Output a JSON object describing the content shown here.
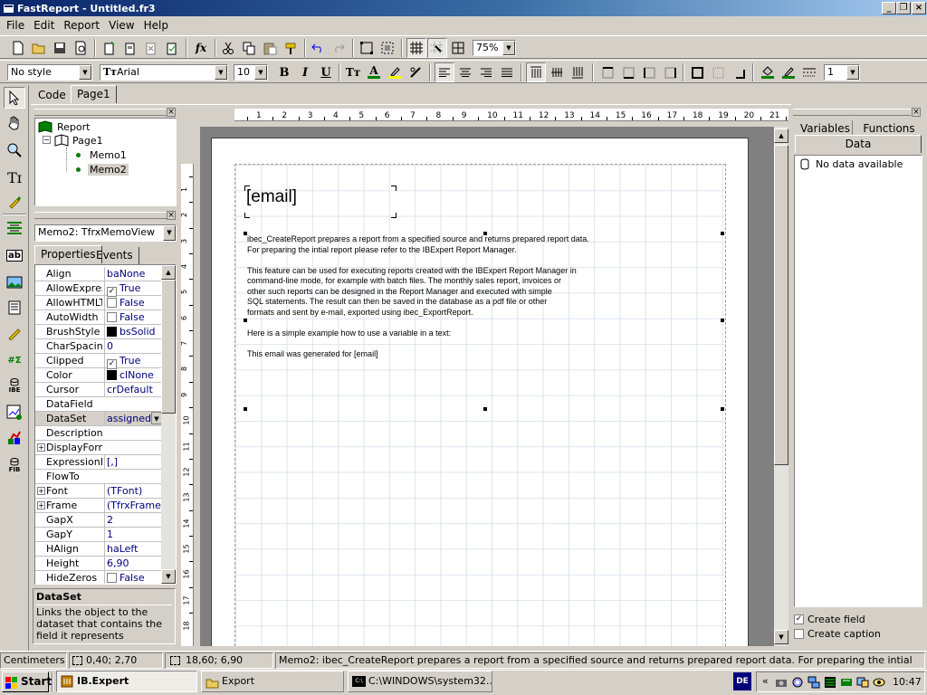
{
  "window": {
    "title": "FastReport - Untitled.fr3"
  },
  "menu": [
    "File",
    "Edit",
    "Report",
    "View",
    "Help"
  ],
  "toolbar": {
    "zoom": "75%"
  },
  "format_bar": {
    "style": "No style",
    "font": "Arial",
    "size": "10",
    "line_width": "1"
  },
  "designer_tabs": [
    "Code",
    "Page1"
  ],
  "tree": {
    "root": "Report",
    "page": "Page1",
    "items": [
      "Memo1",
      "Memo2"
    ]
  },
  "inspector": {
    "object": "Memo2: TfrxMemoView",
    "tabs": [
      "Properties",
      "Events"
    ],
    "rows": [
      {
        "name": "Align",
        "value": "baNone"
      },
      {
        "name": "AllowExpressions",
        "value": "True",
        "check": true
      },
      {
        "name": "AllowHTMLTags",
        "value": "False",
        "check": false
      },
      {
        "name": "AutoWidth",
        "value": "False",
        "check": false
      },
      {
        "name": "BrushStyle",
        "value": "bsSolid",
        "swatch": true
      },
      {
        "name": "CharSpacing",
        "value": "0"
      },
      {
        "name": "Clipped",
        "value": "True",
        "check": true
      },
      {
        "name": "Color",
        "value": "clNone",
        "swatch": true
      },
      {
        "name": "Cursor",
        "value": "crDefault"
      },
      {
        "name": "DataField",
        "value": ""
      },
      {
        "name": "DataSet",
        "value": "assigned)",
        "selected": true
      },
      {
        "name": "Description",
        "value": ""
      },
      {
        "name": "DisplayFormat",
        "value": "",
        "expand": true
      },
      {
        "name": "ExpressionDelimiters",
        "value": "[,]"
      },
      {
        "name": "FlowTo",
        "value": ""
      },
      {
        "name": "Font",
        "value": "(TFont)",
        "expand": true
      },
      {
        "name": "Frame",
        "value": "(TfrxFrame)",
        "expand": true
      },
      {
        "name": "GapX",
        "value": "2"
      },
      {
        "name": "GapY",
        "value": "1"
      },
      {
        "name": "HAlign",
        "value": "haLeft"
      },
      {
        "name": "Height",
        "value": "6,90"
      },
      {
        "name": "HideZeros",
        "value": "False",
        "check": false
      }
    ],
    "help_title": "DataSet",
    "help_text": "Links the object to the dataset that contains the field it represents"
  },
  "ruler_h": [
    "1",
    "2",
    "3",
    "4",
    "5",
    "6",
    "7",
    "8",
    "9",
    "10",
    "11",
    "12",
    "13",
    "14",
    "15",
    "16",
    "17",
    "18",
    "19",
    "20",
    "21"
  ],
  "ruler_v": [
    "1",
    "2",
    "3",
    "4",
    "5",
    "6",
    "7",
    "8",
    "9",
    "10",
    "11",
    "12",
    "13",
    "14",
    "15",
    "16",
    "17",
    "18"
  ],
  "report": {
    "memo1": "[email]",
    "memo2_lines": [
      "ibec_CreateReport prepares a report from a specified source and returns prepared report data.",
      "For preparing the intial report please refer to the IBExpert Report Manager.",
      "",
      "This feature can be used for executing reports created with the IBExpert Report Manager in",
      "command-line mode, for example with batch files. The monthly sales report, invoices or",
      "other such reports can be designed in the Report Manager and executed with simple",
      "SQL statements. The result can then be saved in the database as a pdf file or other",
      "formats and sent by e-mail, exported using ibec_ExportReport.",
      "",
      "Here is a simple example how to use a variable in a text:",
      "",
      "This email was generated for [email]"
    ]
  },
  "data_tree": {
    "tabs": [
      "Variables",
      "Functions",
      "Data"
    ],
    "empty": "No data available",
    "create_field": "Create field",
    "create_caption": "Create caption"
  },
  "status": {
    "units": "Centimeters",
    "pos": "0,40; 2,70",
    "size": "18,60; 6,90",
    "text": "Memo2: ibec_CreateReport prepares a report from a specified source and returns prepared report data.   For preparing the intial"
  },
  "taskbar": {
    "start": "Start",
    "tasks": [
      "IB.Expert",
      "Export",
      "C:\\WINDOWS\\system32..."
    ],
    "lang": "DE",
    "clock": "10:47"
  }
}
